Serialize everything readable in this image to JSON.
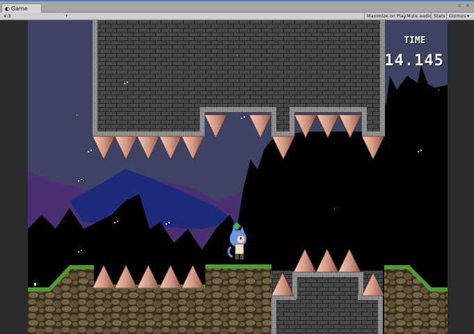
{
  "window": {
    "tab_icon": "unity-icon",
    "tab_title": "Game",
    "window_controls": "▫ ×"
  },
  "toolbar": {
    "aspect_value": "4:3",
    "aspect_caret": "▾",
    "maximize_label": "Maximize on Play",
    "mute_label": "Mute audio",
    "stats_label": "Stats",
    "gizmos_label": "Gizmos",
    "gizmos_caret": "▾"
  },
  "hud": {
    "time_label": "TIME",
    "time_value": "14.145"
  },
  "colors": {
    "sky": "#3d4360",
    "mountain_purple": "#4a2f73",
    "mountain_blue": "#1c2a78",
    "stone_dark": "#3a3a3a",
    "spike": "#d9a28e",
    "grass": "#4d9a2e",
    "dirt": "#6a5a3a"
  }
}
